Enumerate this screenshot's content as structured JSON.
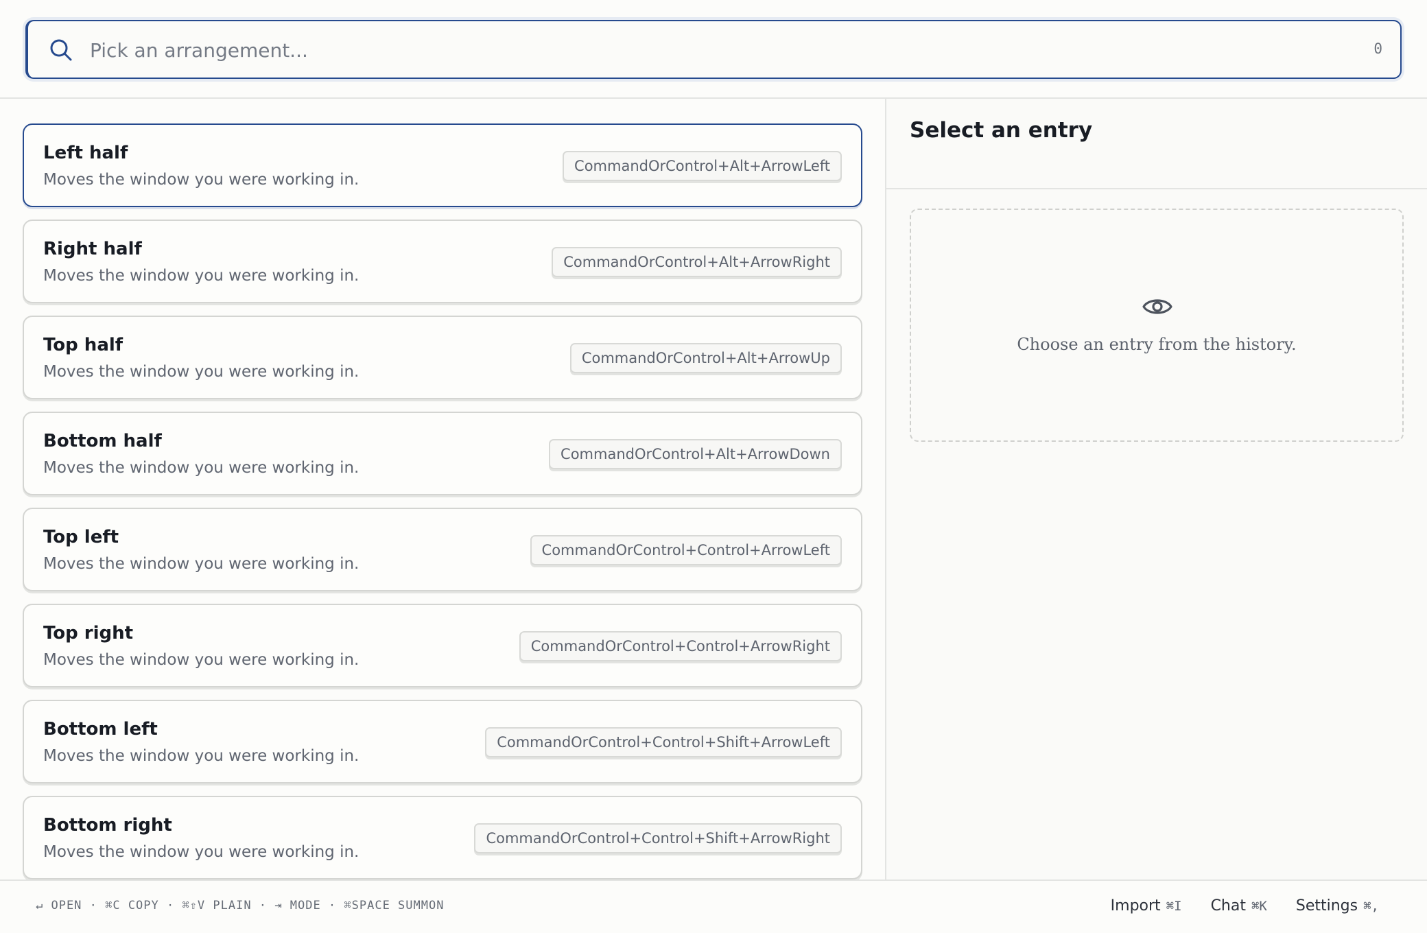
{
  "search": {
    "placeholder": "Pick an arrangement...",
    "value": "",
    "count": "0"
  },
  "arrangements": [
    {
      "title": "Left half",
      "subtitle": "Moves the window you were working in.",
      "shortcut": "CommandOrControl+Alt+ArrowLeft"
    },
    {
      "title": "Right half",
      "subtitle": "Moves the window you were working in.",
      "shortcut": "CommandOrControl+Alt+ArrowRight"
    },
    {
      "title": "Top half",
      "subtitle": "Moves the window you were working in.",
      "shortcut": "CommandOrControl+Alt+ArrowUp"
    },
    {
      "title": "Bottom half",
      "subtitle": "Moves the window you were working in.",
      "shortcut": "CommandOrControl+Alt+ArrowDown"
    },
    {
      "title": "Top left",
      "subtitle": "Moves the window you were working in.",
      "shortcut": "CommandOrControl+Control+ArrowLeft"
    },
    {
      "title": "Top right",
      "subtitle": "Moves the window you were working in.",
      "shortcut": "CommandOrControl+Control+ArrowRight"
    },
    {
      "title": "Bottom left",
      "subtitle": "Moves the window you were working in.",
      "shortcut": "CommandOrControl+Control+Shift+ArrowLeft"
    },
    {
      "title": "Bottom right",
      "subtitle": "Moves the window you were working in.",
      "shortcut": "CommandOrControl+Control+Shift+ArrowRight"
    }
  ],
  "selected_index": 0,
  "detail": {
    "title": "Select an entry",
    "empty_icon": "eye-icon",
    "empty_text": "Choose an entry from the history."
  },
  "footer": {
    "hints": "↵ OPEN · ⌘C COPY · ⌘⇧V PLAIN · ⇥ MODE · ⌘SPACE SUMMON",
    "actions": [
      {
        "label": "Import",
        "key": "⌘I"
      },
      {
        "label": "Chat",
        "key": "⌘K"
      },
      {
        "label": "Settings",
        "key": "⌘,"
      }
    ]
  },
  "colors": {
    "accent": "#264a8e",
    "background": "#fcfcfa",
    "border": "#d4d5d2",
    "muted_text": "#5f6570"
  }
}
